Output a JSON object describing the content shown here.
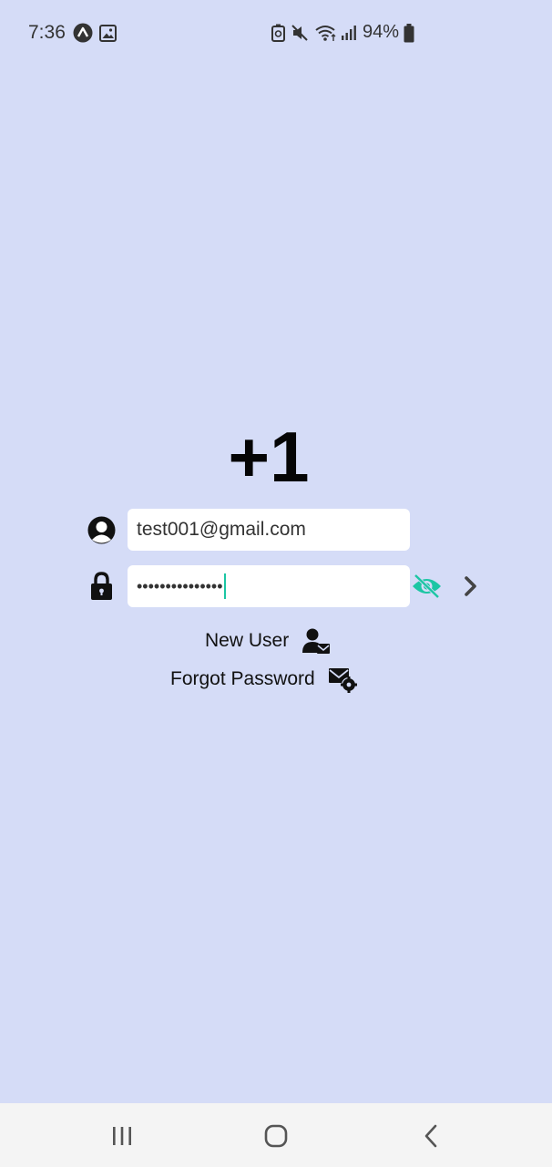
{
  "status_bar": {
    "time": "7:36",
    "battery": "94%"
  },
  "app": {
    "logo_text": "+1"
  },
  "login": {
    "email_value": "test001@gmail.com",
    "password_mask": "•••••••••••••••",
    "new_user_label": "New User",
    "forgot_password_label": "Forgot Password"
  },
  "colors": {
    "background": "#d5dcf7",
    "accent": "#1cc6a4"
  },
  "icons": [
    "user-icon",
    "lock-icon",
    "eye-off-icon",
    "chevron-right-icon",
    "user-mail-icon",
    "mail-gear-icon"
  ]
}
